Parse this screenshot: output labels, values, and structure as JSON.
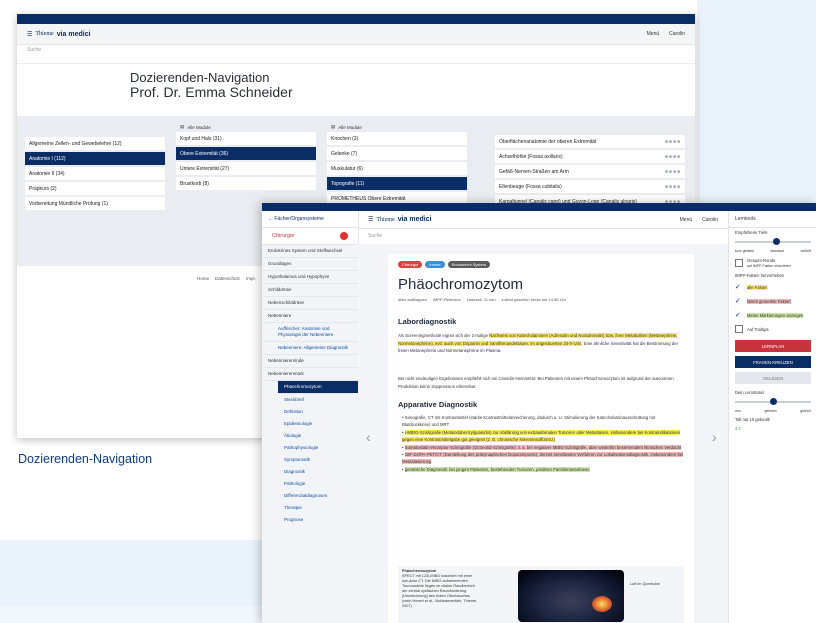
{
  "caption": "Dozierenden-Navigation",
  "colors": {
    "navy": "#0b2d66",
    "red": "#c8343d",
    "highlight_yellow": "#f6ee54"
  },
  "window1": {
    "brand": "Thieme",
    "brand_bold": "via medici",
    "menu": "Menü",
    "user": "Carolin",
    "search_placeholder": "Suche",
    "title_line1": "Dozierenden-Navigation",
    "title_line2": "Prof. Dr. Emma Schneider",
    "col1": [
      "Allgemeine Zellen- und Gewebelehre (12)",
      "Anatomie I (112)",
      "Anatomie II (34)",
      "Präpkurs (2)",
      "Vorbereitung Mündliche Prüfung (1)"
    ],
    "col2_head": "Alle Module",
    "col2": [
      "Kopf und Hals (31)",
      "Obere Extremität (36)",
      "Untere Extremität (27)",
      "Brustkorb (8)"
    ],
    "col3_head": "Alle Module",
    "col3": [
      "Knochen (3)",
      "Gelenke (7)",
      "Muskulatur (6)",
      "Topografie (11)",
      "PROMETHEUS Obere Extremität"
    ],
    "col4": [
      "Oberflächenanatomie der oberen Extremität",
      "Achselhöhle (Fossa axillaris)",
      "Gefäß-Nerven-Straßen am Arm",
      "Ellenbeuge (Fossa cubitalis)",
      "Karpaltunnel (Canalis carpi) und Guyon-Loge (Canalis ulnaris)"
    ],
    "footer": [
      "Home",
      "Datenschutz",
      "Impr."
    ]
  },
  "window2": {
    "back_label": "Fächer/Organsysteme",
    "subject": "Chirurgie",
    "menu": "Menü",
    "user": "Carolin",
    "search_placeholder": "Suche",
    "nav": [
      {
        "label": "Endokrines System und Stoffwechsel",
        "style": "plain"
      },
      {
        "label": "Grundlagen",
        "style": "plain"
      },
      {
        "label": "Hypothalamus und Hypophyse",
        "style": "plain"
      },
      {
        "label": "Schilddrüse",
        "style": "plain"
      },
      {
        "label": "Nebenschilddrüse",
        "style": "plain"
      },
      {
        "label": "Nebenniere",
        "style": "plain"
      },
      {
        "label": "Auffrischer: Anatomie und Physiologie der Nebenniere",
        "style": "ind"
      },
      {
        "label": "Nebenniere: Allgemeine Diagnostik",
        "style": "ind"
      },
      {
        "label": "Nebennierenrinde",
        "style": "plain"
      },
      {
        "label": "Nebennierenmark",
        "style": "plain"
      },
      {
        "label": "Phäochromozytom",
        "style": "sel"
      },
      {
        "label": "Steckbrief",
        "style": "sub"
      },
      {
        "label": "Definition",
        "style": "sub"
      },
      {
        "label": "Epidemiologie",
        "style": "sub"
      },
      {
        "label": "Ätiologie",
        "style": "sub"
      },
      {
        "label": "Pathophysiologie",
        "style": "sub"
      },
      {
        "label": "Symptomatik",
        "style": "sub"
      },
      {
        "label": "Diagnostik",
        "style": "sub"
      },
      {
        "label": "Pathologie",
        "style": "sub"
      },
      {
        "label": "Differenzialdiagnosen",
        "style": "sub"
      },
      {
        "label": "Therapie",
        "style": "sub"
      },
      {
        "label": "Prognose",
        "style": "sub"
      }
    ],
    "tags": [
      {
        "label": "Chirurgie",
        "color": "#d8443f"
      },
      {
        "label": "Innere",
        "color": "#3a8fd6"
      },
      {
        "label": "Endokrines System",
        "color": "#5b5b5b"
      }
    ],
    "article_title": "Phäochromozytom",
    "meta": [
      "alles aufklappen",
      "IMPP-Relevanz",
      "Lesezeit: 11 min",
      "zuletzt gesehen heute um 14:38 Uhr"
    ],
    "sec1": "Labordiagnostik",
    "para1a": "Als Screeningmethode eignet sich der 2-malige ",
    "para1_hl": "Nachweis von Katecholaminen (Adrenalin und Noradrenalin) bzw. ihrer Metaboliten (Metanephrine, Normetanephrine), evtl. auch von Dopamin und Vanillinmandelsäure, im angesäuerten 24-h-Urin",
    "para1b": ". Eine ähnliche Sensitivität hat die Bestimmung der freien Metanephrine und Normetanephrine im Plasma.",
    "para2": "Bei nicht eindeutigen Ergebnissen empfiehlt sich ein Clonidin-Hemmtest: Bei Patienten mit einem Phäochromozytom ist aufgrund der autonomen Produktion keine Suppression erkennbar.",
    "sec2": "Apparative Diagnostik",
    "list": [
      {
        "label": "Sonografie, CT mit Kontrastmittel (starke Kontrastmittelanreicherung, dadurch u. U. Stimulierung der Katecholaminausschüttung mit Blutdruckkrise) und MRT",
        "hl": ""
      },
      {
        "label": "I-MIBG-Szintigrafie (Metaiodobenzylguanidin) zur Abklärung von extraadrenalen Tumoren oder Metastasen, insbesondere bei Kontraindikationen gegen eine Kontrastmittelgabe gut geeignet (z. B. chronische Niereninsuffizienz)",
        "hl": "hl"
      },
      {
        "label": "Somatostatin-Rezeptor-Szintigrafie (Octreotid-Szintigrafie): v. a. bei negativer MIBG-Szintigrafie, aber weiterhin bestehendem klinischen Verdacht",
        "hl": "hl2"
      },
      {
        "label": "18F-DOPA-PET/CT (Darstellung des präsynaptischen Dopaminpools): derzeit sensitivstes Verfahren zur Lokalisationsdiagnostik, insbesondere bei Metastasierung",
        "hl": "hl2"
      },
      {
        "label": "genetische Diagnostik: bei jungen Patienten, bestehenden Tumoren, positiver Familienanamnese",
        "hl": "hl3"
      }
    ],
    "fig_title": "Phäochromozytom",
    "fig_caption": "SPECT mit 123I-MIBG fusioniert mit einer low-dose CT. Die MIBG aufnehmenden Tumoranteile liegen im vitalen Randbereich der zentral zystischen Raumforderung. (Umzeichnung) des linken Oberbauches. (nach Hovert et al., Nuklearmedizin, Thieme, 2007)",
    "fig_label": "Luft im Querkolon",
    "right": {
      "title": "Lerntools",
      "slider1_label": "Empfohlene Tiefe",
      "slider1_ticks": [
        "kurz gefasst",
        "standard",
        "vertieft"
      ],
      "slider1_value": 0.55,
      "opt1": "Gesamt-Rende",
      "opt1_sub": "auf IMPP-Fakten reduzieren",
      "impp_label": "IMPP-Fakten hervorheben",
      "opt2": "alle Fakten",
      "opt3": "falsch gemerkte Fakten",
      "opt4": "Meine Markierungen anzeigen",
      "opt5": "Auf Tooltips",
      "btn1": "LERNPLAN",
      "btn2": "FRAGEN KREUZEN",
      "btn3": "GELESEN",
      "slider2_label": "Dein Lernstatus",
      "slider2_ticks": [
        "neu",
        "gelesen",
        "gelernt"
      ],
      "slider2_value": 0.5,
      "stat_label": "Tall nat 10 geknallt",
      "stat_vals": "4   2"
    }
  }
}
